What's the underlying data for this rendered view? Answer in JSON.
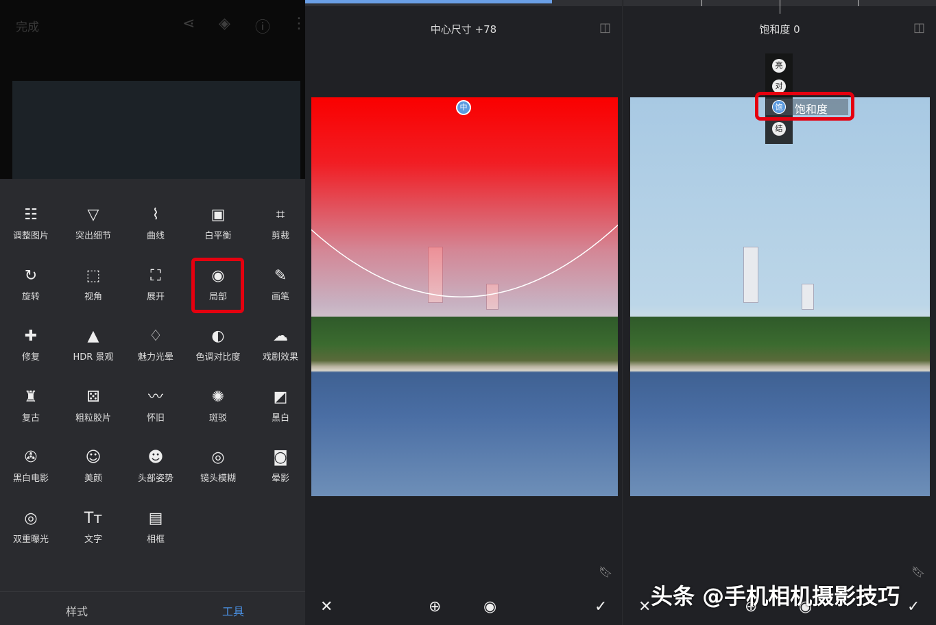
{
  "left_panel": {
    "done_label": "完成",
    "toolbar_icons": [
      "share-icon",
      "undo-layers-icon",
      "info-icon",
      "more-icon"
    ],
    "tools": [
      {
        "label": "调整图片",
        "icon": "☷"
      },
      {
        "label": "突出细节",
        "icon": "▽"
      },
      {
        "label": "曲线",
        "icon": "⌇"
      },
      {
        "label": "白平衡",
        "icon": "▣"
      },
      {
        "label": "剪裁",
        "icon": "⌗"
      },
      {
        "label": "旋转",
        "icon": "↻"
      },
      {
        "label": "视角",
        "icon": "⬚"
      },
      {
        "label": "展开",
        "icon": "⛶"
      },
      {
        "label": "局部",
        "icon": "◉"
      },
      {
        "label": "画笔",
        "icon": "✎"
      },
      {
        "label": "修复",
        "icon": "✚"
      },
      {
        "label": "HDR 景观",
        "icon": "▲"
      },
      {
        "label": "魅力光晕",
        "icon": "♢"
      },
      {
        "label": "色调对比度",
        "icon": "◐"
      },
      {
        "label": "戏剧效果",
        "icon": "☁"
      },
      {
        "label": "复古",
        "icon": "♜"
      },
      {
        "label": "粗粒胶片",
        "icon": "⚄"
      },
      {
        "label": "怀旧",
        "icon": "〰"
      },
      {
        "label": "斑驳",
        "icon": "✺"
      },
      {
        "label": "黑白",
        "icon": "◩"
      },
      {
        "label": "黑白电影",
        "icon": "✇"
      },
      {
        "label": "美颜",
        "icon": "☺"
      },
      {
        "label": "头部姿势",
        "icon": "☻"
      },
      {
        "label": "镜头模糊",
        "icon": "◎"
      },
      {
        "label": "晕影",
        "icon": "◙"
      },
      {
        "label": "双重曝光",
        "icon": "◎"
      },
      {
        "label": "文字",
        "icon": "Tт"
      },
      {
        "label": "相框",
        "icon": "▤"
      }
    ],
    "highlighted_tool": "局部",
    "tabs": [
      {
        "label": "样式",
        "active": false
      },
      {
        "label": "工具",
        "active": true
      }
    ],
    "accent_color": "#4a90e2"
  },
  "middle_panel": {
    "title": "中心尺寸 +78",
    "progress_percent": 78,
    "pin_label": "中",
    "bottom_icons": [
      "close-icon",
      "add-point-icon",
      "eye-icon",
      "check-icon"
    ]
  },
  "right_panel": {
    "title": "饱和度 0",
    "menu_items": [
      "亮",
      "对",
      "饱",
      "结"
    ],
    "selected_item": "饱和度",
    "bottom_icons": [
      "close-icon",
      "add-point-icon",
      "eye-icon",
      "check-icon"
    ]
  },
  "watermark": "头条 @手机相机摄影技巧"
}
